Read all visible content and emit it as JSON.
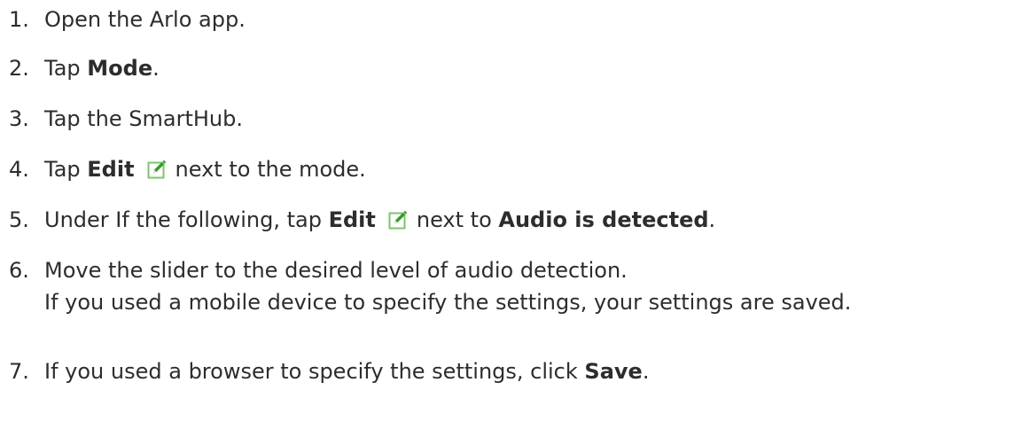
{
  "steps": [
    {
      "number": "1.",
      "text": "Open the Arlo app."
    },
    {
      "number": "2.",
      "pre": "Tap ",
      "bold": "Mode",
      "post": "."
    },
    {
      "number": "3.",
      "text": "Tap the SmartHub."
    },
    {
      "number": "4.",
      "pre": "Tap ",
      "bold": "Edit",
      "post": "next to the mode."
    },
    {
      "number": "5.",
      "pre": "Under If the following, tap ",
      "bold": "Edit",
      "mid": "next to ",
      "bold2": "Audio is detected",
      "post": "."
    },
    {
      "number": "6.",
      "text": "Move the slider to the desired level of audio detection.",
      "note": "If you used a mobile device to specify the settings, your settings are saved."
    },
    {
      "number": "7.",
      "pre": "If you used a browser to specify the settings, click ",
      "bold": "Save",
      "post": "."
    }
  ],
  "icons": {
    "edit": "edit-pencil-icon"
  },
  "colors": {
    "text": "#2d2d2d",
    "icon_frame": "#7dc56b",
    "icon_pencil": "#3a9a2e"
  }
}
